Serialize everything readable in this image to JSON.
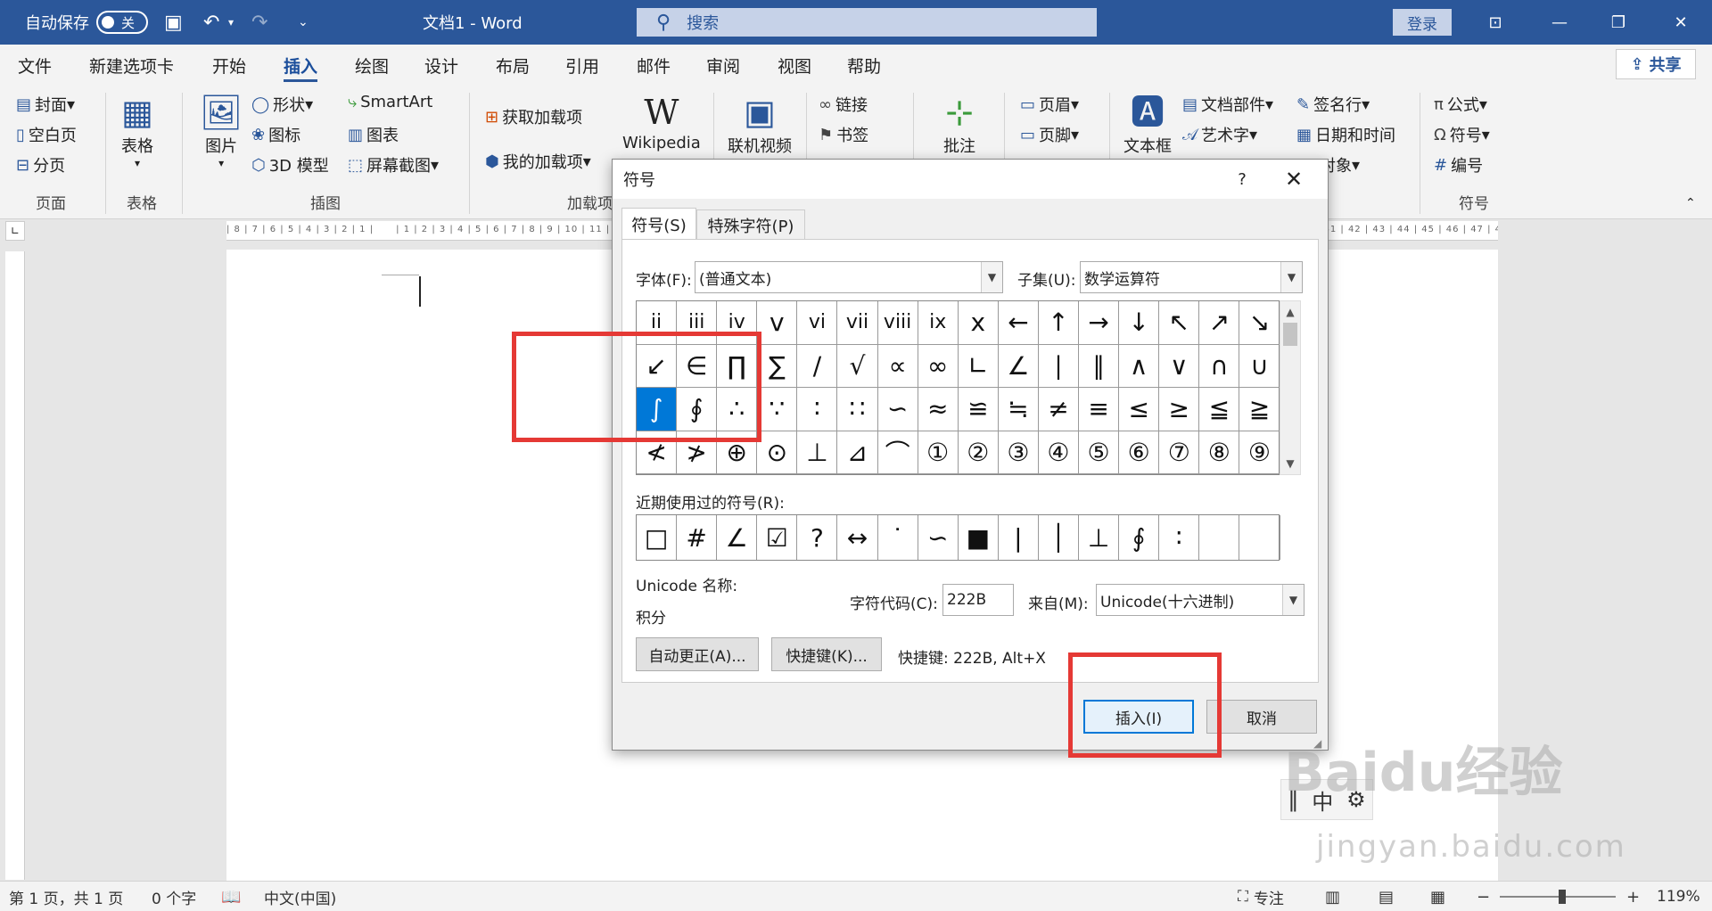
{
  "titlebar": {
    "autosave_label": "自动保存",
    "autosave_state": "关",
    "doc_title": "文档1  -  Word",
    "search_placeholder": "搜索",
    "login": "登录",
    "colors": {
      "brand": "#2b579a"
    }
  },
  "menu": {
    "tabs": [
      "文件",
      "新建选项卡",
      "开始",
      "插入",
      "绘图",
      "设计",
      "布局",
      "引用",
      "邮件",
      "审阅",
      "视图",
      "帮助"
    ],
    "active": "插入",
    "share": "共享"
  },
  "ribbon": {
    "pages": {
      "cover": "封面",
      "blank": "空白页",
      "break": "分页",
      "group": "页面"
    },
    "tables": {
      "table": "表格",
      "group": "表格"
    },
    "illustrations": {
      "picture": "图片",
      "shapes": "形状",
      "icons": "图标",
      "model3d": "3D 模型",
      "smartart": "SmartArt",
      "chart": "图表",
      "screenshot": "屏幕截图",
      "group": "插图"
    },
    "addins": {
      "get": "获取加载项",
      "mine": "我的加载项",
      "wikipedia": "Wikipedia",
      "group": "加载项"
    },
    "media": {
      "video": "联机视频"
    },
    "links": {
      "link": "链接",
      "bookmark": "书签"
    },
    "comments": {
      "comment": "批注"
    },
    "headerfooter": {
      "header": "页眉",
      "footer": "页脚"
    },
    "text": {
      "textbox": "文本框",
      "parts": "文档部件",
      "wordart": "艺术字",
      "signature": "签名行",
      "datetime": "日期和时间",
      "object": "对象"
    },
    "symbols": {
      "equation": "公式",
      "symbol": "符号",
      "number": "编号",
      "group": "符号"
    }
  },
  "statusbar": {
    "page": "第 1 页，共 1 页",
    "words": "0 个字",
    "language": "中文(中国)",
    "focus": "专注",
    "zoom": "119%"
  },
  "dialog": {
    "title": "符号",
    "help": "?",
    "tabs": [
      "符号(S)",
      "特殊字符(P)"
    ],
    "font_label": "字体(F):",
    "font_value": "(普通文本)",
    "subset_label": "子集(U):",
    "subset_value": "数学运算符",
    "symbols": [
      [
        "ii",
        "iii",
        "iv",
        "v",
        "vi",
        "vii",
        "viii",
        "ix",
        "x",
        "←",
        "↑",
        "→",
        "↓",
        "↖",
        "↗",
        "↘"
      ],
      [
        "↙",
        "∈",
        "∏",
        "∑",
        "∕",
        "√",
        "∝",
        "∞",
        "∟",
        "∠",
        "∣",
        "∥",
        "∧",
        "∨",
        "∩",
        "∪"
      ],
      [
        "∫",
        "∮",
        "∴",
        "∵",
        "∶",
        "∷",
        "∽",
        "≈",
        "≌",
        "≒",
        "≠",
        "≡",
        "≤",
        "≥",
        "≦",
        "≧"
      ],
      [
        "≮",
        "≯",
        "⊕",
        "⊙",
        "⊥",
        "⊿",
        "⌒",
        "①",
        "②",
        "③",
        "④",
        "⑤",
        "⑥",
        "⑦",
        "⑧",
        "⑨"
      ]
    ],
    "selected_symbol": "∫",
    "recent_label": "近期使用过的符号(R):",
    "recent": [
      "□",
      "#",
      "∠",
      "☑",
      "?",
      "↔",
      "˙",
      "∽",
      "■",
      "|",
      "│",
      "⊥",
      "∮",
      "∶",
      "",
      ""
    ],
    "unicode_name_label": "Unicode 名称:",
    "unicode_name": "积分",
    "charcode_label": "字符代码(C):",
    "charcode_value": "222B",
    "from_label": "来自(M):",
    "from_value": "Unicode(十六进制)",
    "autocorrect_btn": "自动更正(A)...",
    "shortcut_btn": "快捷键(K)...",
    "shortcut_text": "快捷键: 222B, Alt+X",
    "insert_btn": "插入(I)",
    "cancel_btn": "取消"
  },
  "watermark": {
    "brand": "Baidu经验",
    "url": "jingyan.baidu.com"
  }
}
